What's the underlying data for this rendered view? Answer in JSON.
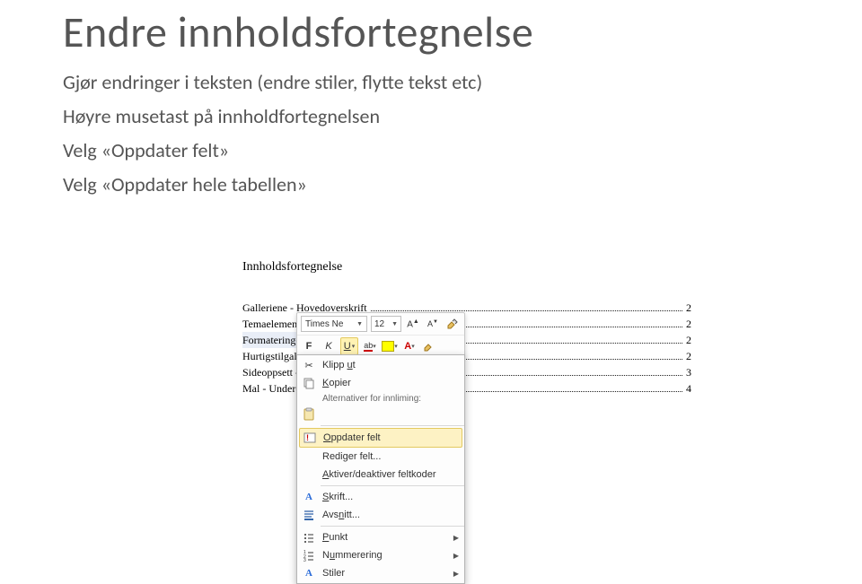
{
  "slide": {
    "title": "Endre innholdsfortegnelse",
    "lines": [
      "Gjør endringer i teksten (endre stiler, flytte tekst etc)",
      "Høyre musetast på innholdfortegnelsen",
      "Velg «Oppdater felt»",
      "Velg «Oppdater hele tabellen»"
    ]
  },
  "embedded": {
    "toc_heading": "Innholdsfortegnelse",
    "rows": [
      {
        "label": "Galleriene - Hovedoverskrift",
        "page": "2",
        "selected": false
      },
      {
        "label": "Temaelementer - Underoverskrift",
        "page": "2",
        "selected": false
      },
      {
        "label": "Formateringen - Underoverskrift",
        "page": "2",
        "selected": true
      },
      {
        "label": "Hurtigstilgalleriet - Underoverskrift",
        "page": "2",
        "selected": false
      },
      {
        "label": "Sideoppsett - Underoverskrift",
        "page": "3",
        "selected": false
      },
      {
        "label": "Mal - Underoverskrift",
        "page": "4",
        "selected": false
      }
    ]
  },
  "mini_toolbar": {
    "font_name": "Times Ne",
    "font_size": "12",
    "buttons": [
      "grow-font",
      "shrink-font",
      "format-painter"
    ],
    "row2": {
      "bold": "F",
      "italic": "K",
      "underline": "U"
    }
  },
  "context_menu": {
    "cut": "Klipp ut",
    "copy": "Kopier",
    "paste_section": "Alternativer for innliming:",
    "update_field": "Oppdater felt",
    "edit_field": "Rediger felt...",
    "toggle_codes": "Aktiver/deaktiver feltkoder",
    "font": "Skrift...",
    "paragraph": "Avsnitt...",
    "bullets": "Punkt",
    "numbering": "Nummerering",
    "styles": "Stiler"
  }
}
